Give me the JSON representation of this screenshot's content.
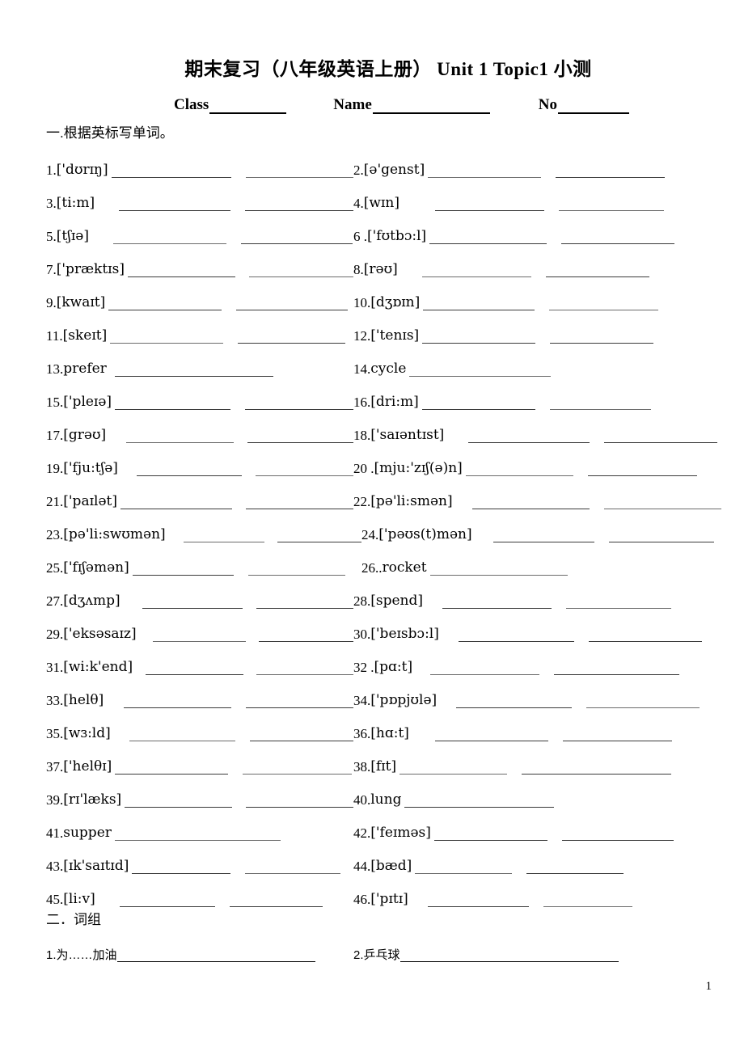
{
  "document": {
    "title": "期末复习（八年级英语上册）  Unit 1 Topic1 小测",
    "page_number": "1"
  },
  "header": {
    "class_label": "Class",
    "name_label": "Name",
    "no_label": "No"
  },
  "sections": [
    {
      "heading": "一.根据英标写单词。",
      "items": [
        {
          "num": "1.",
          "cue": "['dʊrɪŋ]",
          "blanks": 2
        },
        {
          "num": "2.",
          "cue": "[ə'genst]",
          "blanks": 2
        },
        {
          "num": "3.",
          "cue": "[ti:m]",
          "blanks": 2
        },
        {
          "num": "4.",
          "cue": "[wɪn]",
          "blanks": 2
        },
        {
          "num": "5.",
          "cue": "[tʃɪə]",
          "blanks": 2
        },
        {
          "num": "6 .",
          "cue": "['fʊtbɔ:l]",
          "blanks": 2
        },
        {
          "num": "7.",
          "cue": "['præktɪs]",
          "blanks": 2
        },
        {
          "num": "8.",
          "cue": "[rəʊ]",
          "blanks": 2
        },
        {
          "num": "9.",
          "cue": "[kwaɪt]",
          "blanks": 2
        },
        {
          "num": "10.",
          "cue": "[dʒɒɪn]",
          "blanks": 2
        },
        {
          "num": "11.",
          "cue": "[skeɪt]",
          "blanks": 2
        },
        {
          "num": "12.",
          "cue": "['tenɪs]",
          "blanks": 2
        },
        {
          "num": "13.",
          "cue": "prefer",
          "blanks": 1
        },
        {
          "num": "14.",
          "cue": "cycle",
          "blanks": 1
        },
        {
          "num": "15.",
          "cue": "['pleɪə]",
          "blanks": 2
        },
        {
          "num": "16.",
          "cue": "[dri:m]",
          "blanks": 2
        },
        {
          "num": "17.",
          "cue": "[grəʊ]",
          "blanks": 2
        },
        {
          "num": "18.",
          "cue": "['saɪəntɪst]",
          "blanks": 2
        },
        {
          "num": "19.",
          "cue": "['fju:tʃə]",
          "blanks": 2
        },
        {
          "num": "20 .",
          "cue": "[mju:'zɪʃ(ə)n]",
          "blanks": 2
        },
        {
          "num": "21.",
          "cue": "['paɪlət]",
          "blanks": 2
        },
        {
          "num": "22.",
          "cue": "[pə'li:smən]",
          "blanks": 2
        },
        {
          "num": "23.",
          "cue": "[pə'li:swʊmən]",
          "blanks": 2
        },
        {
          "num": "24.",
          "cue": "['pəʊs(t)mən]",
          "blanks": 2
        },
        {
          "num": "25.",
          "cue": "['fɪʃəmən]",
          "blanks": 2
        },
        {
          "num": "26..",
          "cue": "rocket",
          "blanks": 1
        },
        {
          "num": "27.",
          "cue": "[dʒʌmp]",
          "blanks": 2
        },
        {
          "num": "28.",
          "cue": "[spend]",
          "blanks": 2
        },
        {
          "num": "29.",
          "cue": "['eksəsaɪz]",
          "blanks": 2
        },
        {
          "num": "30.",
          "cue": "['beɪsbɔ:l]",
          "blanks": 2
        },
        {
          "num": "31.",
          "cue": "[wi:k'end]",
          "blanks": 2
        },
        {
          "num": "32 .",
          "cue": "[pɑ:t]",
          "blanks": 2
        },
        {
          "num": "33.",
          "cue": "[helθ]",
          "blanks": 2
        },
        {
          "num": "34.",
          "cue": "['pɒpjʊlə]",
          "blanks": 2
        },
        {
          "num": "35.",
          "cue": "[wɜ:ld]",
          "blanks": 2
        },
        {
          "num": "36.",
          "cue": "[hɑ:t]",
          "blanks": 2
        },
        {
          "num": "37.",
          "cue": "['helθɪ]",
          "blanks": 2
        },
        {
          "num": "38.",
          "cue": "[fɪt]",
          "blanks": 2
        },
        {
          "num": "39.",
          "cue": "[rɪ'læks]",
          "blanks": 2
        },
        {
          "num": "40.",
          "cue": "lung",
          "blanks": 1
        },
        {
          "num": "41.",
          "cue": "supper",
          "blanks": 1
        },
        {
          "num": "42.",
          "cue": "['feɪməs]",
          "blanks": 2
        },
        {
          "num": "43.",
          "cue": "[ɪk'saɪtɪd]",
          "blanks": 2
        },
        {
          "num": "44.",
          "cue": "[bæd]",
          "blanks": 2
        },
        {
          "num": "45.",
          "cue": "[li:v]",
          "blanks": 2
        },
        {
          "num": "46.",
          "cue": "['pɪtɪ]",
          "blanks": 2
        }
      ]
    },
    {
      "heading": "二．词组",
      "items": [
        {
          "num": "1.",
          "cue": "为……加油"
        },
        {
          "num": "2.",
          "cue": "乒乓球"
        }
      ]
    }
  ]
}
